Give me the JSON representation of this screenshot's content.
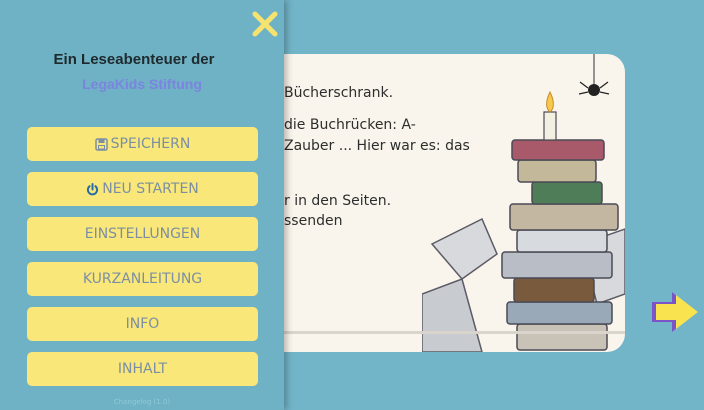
{
  "book": {
    "lines": [
      "Bücherschrank.",
      "die Buchrücken: A-",
      "Zauber ... Hier war es: das",
      "r in den Seiten.",
      "ssenden"
    ]
  },
  "menu": {
    "title": "Ein Leseabenteuer der",
    "subtitle": "LegaKids Stiftung",
    "buttons": {
      "save": "SPEICHERN",
      "restart": "NEU STARTEN",
      "settings": "EINSTELLUNGEN",
      "guide": "KURZANLEITUNG",
      "info": "INFO",
      "contents": "INHALT"
    },
    "changelog": "Changelog (1.0)"
  },
  "colors": {
    "background": "#72b4c8",
    "button": "#f9e779",
    "button_text": "#7c8fa2",
    "close": "#f6e36f",
    "arrow": "#f9e34f",
    "subtitle": "#7b84e0"
  }
}
